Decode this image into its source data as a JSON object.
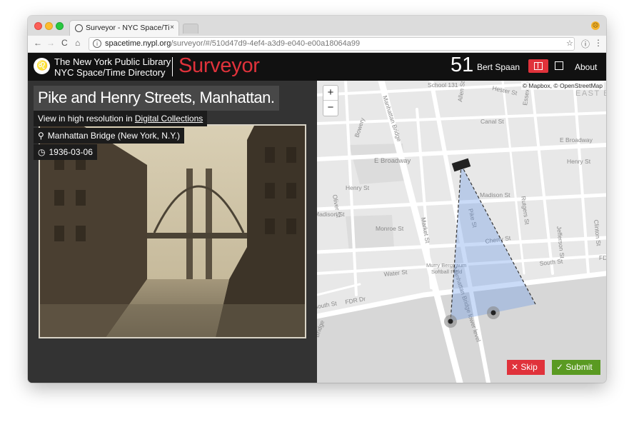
{
  "browser": {
    "tab_title": "Surveyor - NYC Space/Time Di",
    "tab_close": "×",
    "url_host": "spacetime.nypl.org",
    "url_path": "/surveyor/#/510d47d9-4ef4-a3d9-e040-e00a18064a99",
    "back_glyph": "←",
    "forward_glyph": "→",
    "reload_glyph": "C",
    "home_glyph": "⌂",
    "star_glyph": "☆",
    "menu_glyph": "ⓘ",
    "more_glyph": "⋮"
  },
  "header": {
    "org_line1": "The New York Public Library",
    "org_line2": "NYC Space/Time Directory",
    "brand": "Surveyor",
    "score": "51",
    "user": "Bert Spaan",
    "about": "About"
  },
  "photo": {
    "title": "Pike and Henry Streets, Manhattan.",
    "hires_prefix": "View in high resolution in",
    "hires_link": "Digital Collections",
    "location": "Manhattan Bridge (New York, N.Y.)",
    "date": "1936-03-06"
  },
  "map": {
    "zoom_in": "+",
    "zoom_out": "−",
    "attribution": "© Mapbox, © OpenStreetMap",
    "skip": "Skip",
    "submit": "Submit",
    "labels": {
      "school": "School 131",
      "hester": "Hester St",
      "east_bro": "EAST B",
      "manhattan_bridge": "Manhattan Bridge",
      "allen": "Allen St",
      "essex": "Essex St",
      "canal": "Canal St",
      "bowery": "Bowery",
      "e_broadway_r": "E Broadway",
      "e_broadway": "E Broadway",
      "henry_r": "Henry St",
      "henry": "Henry St",
      "oliver": "Oliver St",
      "madison_r": "Madison St",
      "madison": "Madison St",
      "rutgers": "Rutgers St",
      "monroe": "Monroe St",
      "market": "Market St",
      "pike": "Pike St",
      "cherry": "Cherry St",
      "jefferson": "Jefferson St",
      "clinton": "Clinton St",
      "south_r": "South St",
      "fd": "FD",
      "water": "Water St",
      "murry1": "Murry Bergtraum",
      "murry2": "Softball Field",
      "fdr": "FDR Dr",
      "south": "South St",
      "mb_lower": "Manhattan Bridge lower level",
      "bridge_edge": "Bridge"
    }
  }
}
